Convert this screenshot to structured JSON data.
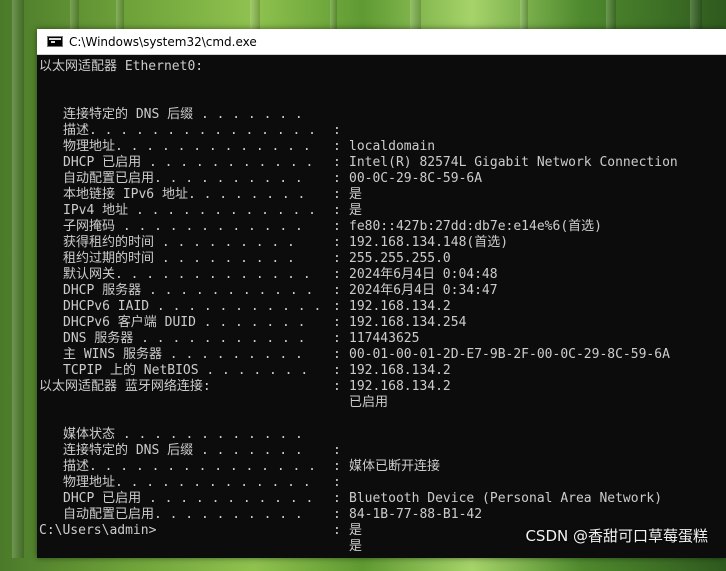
{
  "window": {
    "title": "C:\\Windows\\system32\\cmd.exe"
  },
  "sections": [
    {
      "header": "以太网适配器 Ethernet0:",
      "rows": [
        {
          "key": "连接特定的 DNS 后缀 . . . . . . .",
          "value": "localdomain"
        },
        {
          "key": "描述. . . . . . . . . . . . . . .",
          "value": "Intel(R) 82574L Gigabit Network Connection"
        },
        {
          "key": "物理地址. . . . . . . . . . . . .",
          "value": "00-0C-29-8C-59-6A"
        },
        {
          "key": "DHCP 已启用 . . . . . . . . . . .",
          "value": "是"
        },
        {
          "key": "自动配置已启用. . . . . . . . . .",
          "value": "是"
        },
        {
          "key": "本地链接 IPv6 地址. . . . . . . .",
          "value": "fe80::427b:27dd:db7e:e14e%6(首选)"
        },
        {
          "key": "IPv4 地址 . . . . . . . . . . . .",
          "value": "192.168.134.148(首选)"
        },
        {
          "key": "子网掩码 . . . . . . . . . . . .",
          "value": "255.255.255.0"
        },
        {
          "key": "获得租约的时间 . . . . . . . . .",
          "value": "2024年6月4日 0:04:48"
        },
        {
          "key": "租约过期的时间 . . . . . . . . .",
          "value": "2024年6月4日 0:34:47"
        },
        {
          "key": "默认网关. . . . . . . . . . . . .",
          "value": "192.168.134.2"
        },
        {
          "key": "DHCP 服务器 . . . . . . . . . . .",
          "value": "192.168.134.254"
        },
        {
          "key": "DHCPv6 IAID . . . . . . . . . . .",
          "value": "117443625"
        },
        {
          "key": "DHCPv6 客户端 DUID . . . . . . .",
          "value": "00-01-00-01-2D-E7-9B-2F-00-0C-29-8C-59-6A"
        },
        {
          "key": "DNS 服务器 . . . . . . . . . . .",
          "value": "192.168.134.2"
        },
        {
          "key": "主 WINS 服务器 . . . . . . . . .",
          "value": "192.168.134.2"
        },
        {
          "key": "TCPIP 上的 NetBIOS . . . . . . .",
          "value": "已启用"
        }
      ]
    },
    {
      "header": "以太网适配器 蓝牙网络连接:",
      "rows": [
        {
          "key": "媒体状态 . . . . . . . . . . . .",
          "value": "媒体已断开连接"
        },
        {
          "key": "连接特定的 DNS 后缀 . . . . . . .",
          "value": ""
        },
        {
          "key": "描述. . . . . . . . . . . . . . .",
          "value": "Bluetooth Device (Personal Area Network)"
        },
        {
          "key": "物理地址. . . . . . . . . . . . .",
          "value": "84-1B-77-88-B1-42"
        },
        {
          "key": "DHCP 已启用 . . . . . . . . . . .",
          "value": "是"
        },
        {
          "key": "自动配置已启用. . . . . . . . . .",
          "value": "是"
        }
      ]
    }
  ],
  "prompt": "C:\\Users\\admin>",
  "watermark": "CSDN @香甜可口草莓蛋糕",
  "colors": {
    "console_bg": "#0c0c0c",
    "console_text": "#cccccc",
    "titlebar_bg": "#ffffff"
  }
}
